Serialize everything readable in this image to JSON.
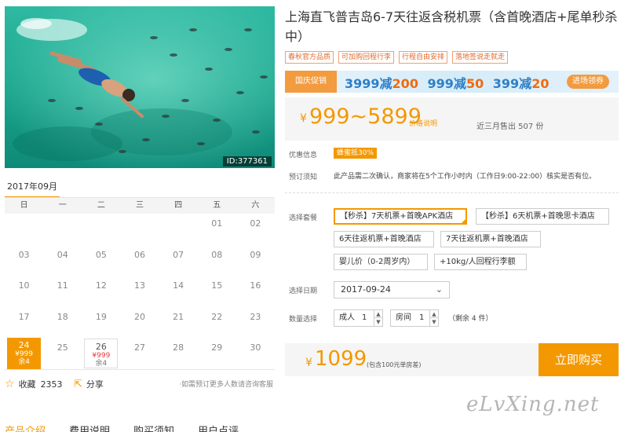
{
  "photo": {
    "id_label": "ID:377361"
  },
  "calendar": {
    "month": "2017年09月",
    "weekdays": [
      "日",
      "一",
      "二",
      "三",
      "四",
      "五",
      "六"
    ],
    "cells": [
      {
        "d": ""
      },
      {
        "d": ""
      },
      {
        "d": ""
      },
      {
        "d": ""
      },
      {
        "d": ""
      },
      {
        "d": "01"
      },
      {
        "d": "02"
      },
      {
        "d": "03"
      },
      {
        "d": "04"
      },
      {
        "d": "05"
      },
      {
        "d": "06"
      },
      {
        "d": "07"
      },
      {
        "d": "08"
      },
      {
        "d": "09"
      },
      {
        "d": "10"
      },
      {
        "d": "11"
      },
      {
        "d": "12"
      },
      {
        "d": "13"
      },
      {
        "d": "14"
      },
      {
        "d": "15"
      },
      {
        "d": "16"
      },
      {
        "d": "17"
      },
      {
        "d": "18"
      },
      {
        "d": "19"
      },
      {
        "d": "20"
      },
      {
        "d": "21"
      },
      {
        "d": "22"
      },
      {
        "d": "23"
      },
      {
        "d": "24",
        "price": "¥999",
        "remain": "余4",
        "state": "selected"
      },
      {
        "d": "25"
      },
      {
        "d": "26",
        "price": "¥999",
        "remain": "余4",
        "state": "available"
      },
      {
        "d": "27"
      },
      {
        "d": "28"
      },
      {
        "d": "29"
      },
      {
        "d": "30"
      }
    ]
  },
  "actions": {
    "favorite_label": "收藏",
    "favorite_count": "2353",
    "share_label": "分享",
    "hint": "·如需预订更多人数请咨询客服"
  },
  "tabs": [
    "产品介绍",
    "费用说明",
    "购买须知",
    "用户点评"
  ],
  "product": {
    "title": "上海直飞普吉岛6-7天往返含税机票（含首晚酒店+尾单秒杀中）",
    "tags": [
      "春秋官方品质",
      "可加购回程行李",
      "行程自由安排",
      "落地签说走就走"
    ]
  },
  "banner": {
    "flag": "国庆促销",
    "deals": [
      {
        "a": "3999减",
        "b": "200"
      },
      {
        "a": "999减",
        "b": "50"
      },
      {
        "a": "399减",
        "b": "20"
      }
    ],
    "button": "进场领券"
  },
  "price": {
    "currency": "¥",
    "range": "999~5899",
    "note": "价格说明",
    "sold": "近三月售出 507 份"
  },
  "promo": {
    "label": "优惠信息",
    "badge": "蜂蜜抵30%"
  },
  "booking_note": {
    "label": "预订须知",
    "text": "此产品需二次确认，商家将在5个工作小时内（工作日9:00-22:00）核实是否有位。"
  },
  "packages": {
    "label": "选择套餐",
    "options": [
      "【秒杀】7天机票+首晚APK酒店",
      "【秒杀】6天机票+首晚思卡酒店",
      "6天往返机票+首晚酒店",
      "7天往返机票+首晚酒店",
      "婴儿价（0-2周岁内）",
      "+10kg/人回程行李额"
    ]
  },
  "date": {
    "label": "选择日期",
    "value": "2017-09-24"
  },
  "quantity": {
    "label": "数量选择",
    "adult_label": "成人",
    "adult_value": "1",
    "room_label": "房间",
    "room_value": "1",
    "remain": "（剩余 4 件）"
  },
  "total": {
    "currency": "¥",
    "value": "1099",
    "note": "(包含100元单房差)",
    "buy_button": "立即购买"
  },
  "watermark": "eLvXing.net",
  "colors": {
    "accent": "#f39800",
    "banner_blue": "#2f7fc6",
    "deal_orange": "#f06a10"
  }
}
